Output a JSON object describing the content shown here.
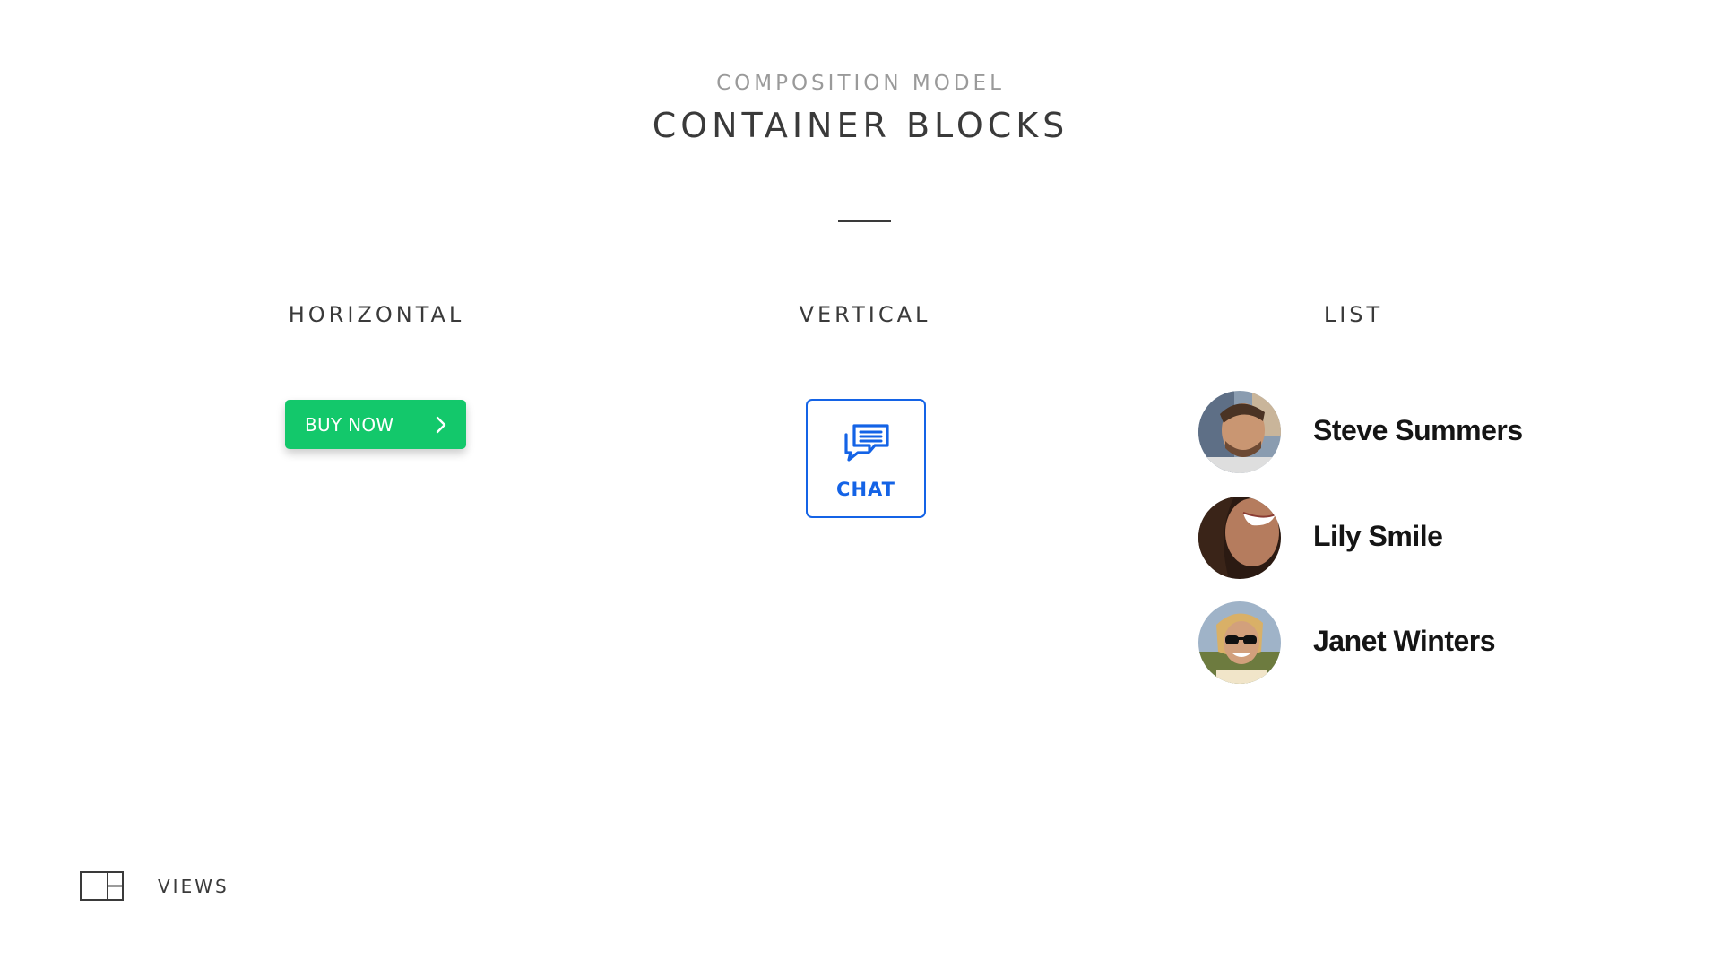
{
  "header": {
    "eyebrow": "COMPOSITION MODEL",
    "title": "CONTAINER BLOCKS"
  },
  "columns": [
    {
      "title": "HORIZONTAL"
    },
    {
      "title": "VERTICAL"
    },
    {
      "title": "LIST"
    }
  ],
  "buy_button": {
    "label": "BUY NOW",
    "icon": "chevron-right-icon",
    "color": "#13c86b"
  },
  "chat_button": {
    "label": "CHAT",
    "icon": "chat-bubbles-icon",
    "color": "#1463e6"
  },
  "contacts": [
    {
      "name": "Steve Summers"
    },
    {
      "name": "Lily Smile"
    },
    {
      "name": "Janet Winters"
    }
  ],
  "footer": {
    "label": "VIEWS",
    "icon": "views-layout-icon"
  }
}
